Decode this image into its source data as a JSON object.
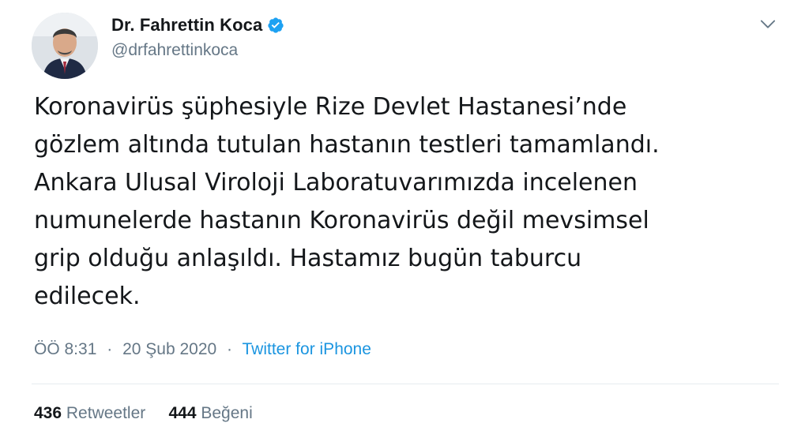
{
  "author": {
    "name": "Dr. Fahrettin Koca",
    "handle": "@drfahrettinkoca",
    "verified": true
  },
  "tweet": {
    "lines": [
      "Koronavirüs şüphesiyle Rize Devlet Hastanesi’nde",
      "gözlem altında tutulan hastanın testleri tamamlandı.",
      "Ankara Ulusal Viroloji Laboratuvarımızda incelenen",
      "numunelerde hastanın Koronavirüs değil mevsimsel",
      "grip olduğu anlaşıldı. Hastamız bugün taburcu",
      "edilecek."
    ]
  },
  "meta": {
    "time": "ÖÖ 8:31",
    "separator": "·",
    "date": "20 Şub 2020",
    "source": "Twitter for iPhone"
  },
  "stats": {
    "retweets_count": "436",
    "retweets_label": "Retweetler",
    "likes_count": "444",
    "likes_label": "Beğeni"
  },
  "colors": {
    "verified": "#1da1f2",
    "link": "#1b95e0",
    "secondary_text": "#657786"
  },
  "icons": {
    "verified": "verified-badge-icon",
    "menu": "chevron-down-icon"
  }
}
